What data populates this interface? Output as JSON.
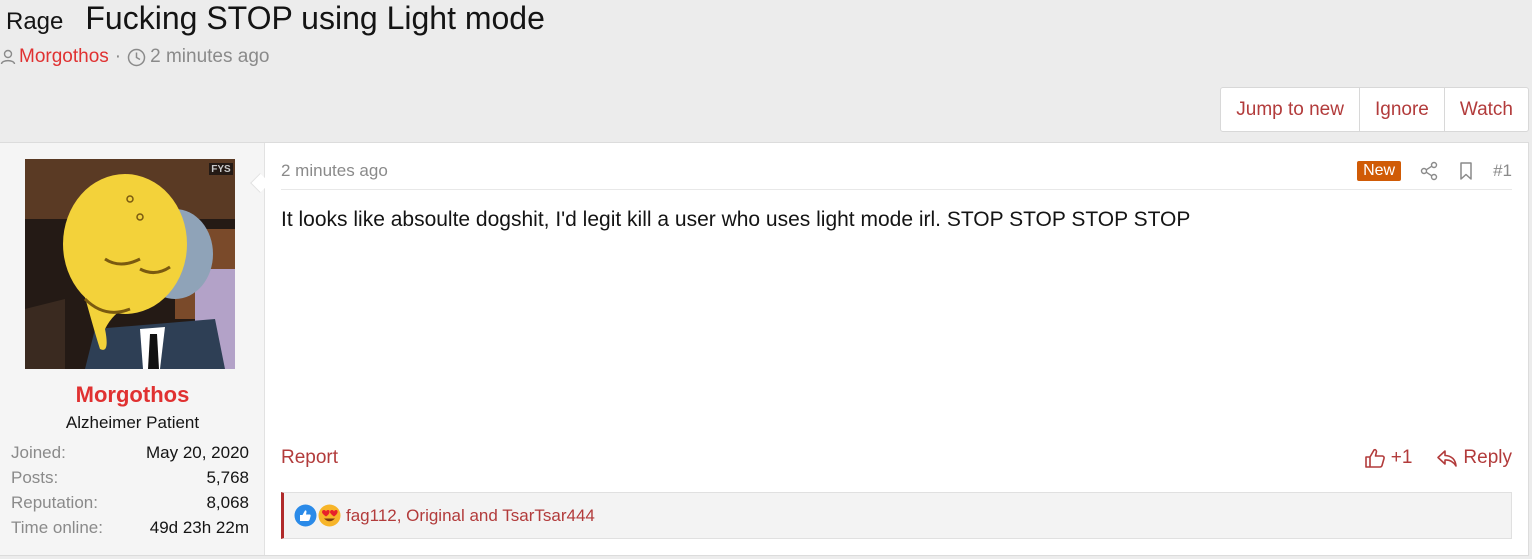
{
  "thread": {
    "prefix": "Rage",
    "title": "Fucking STOP using Light mode",
    "author": "Morgothos",
    "separator": "·",
    "time": "2 minutes ago"
  },
  "buttons": {
    "jump": "Jump to new",
    "ignore": "Ignore",
    "watch": "Watch"
  },
  "post": {
    "username": "Morgothos",
    "user_title": "Alzheimer Patient",
    "stats": [
      {
        "label": "Joined:",
        "value": "May 20, 2020"
      },
      {
        "label": "Posts:",
        "value": "5,768"
      },
      {
        "label": "Reputation:",
        "value": "8,068"
      },
      {
        "label": "Time online:",
        "value": "49d 23h 22m"
      }
    ],
    "date": "2 minutes ago",
    "badge": "New",
    "number": "#1",
    "body": "It looks like absoulte dogshit, I'd legit kill a user who uses light mode irl. STOP STOP STOP STOP",
    "report": "Report",
    "like_count": "+1",
    "reply": "Reply",
    "reactions_names": "fag112, Original and TsarTsar444",
    "avatar_watermark": "FYS"
  },
  "colors": {
    "accent": "#e03131",
    "link": "#b23b3b",
    "badge": "#d05b06"
  },
  "icons": [
    "user-icon",
    "clock-icon",
    "share-icon",
    "bookmark-icon",
    "thumbs-up-icon",
    "reply-icon",
    "like-reaction-icon",
    "love-reaction-icon"
  ]
}
